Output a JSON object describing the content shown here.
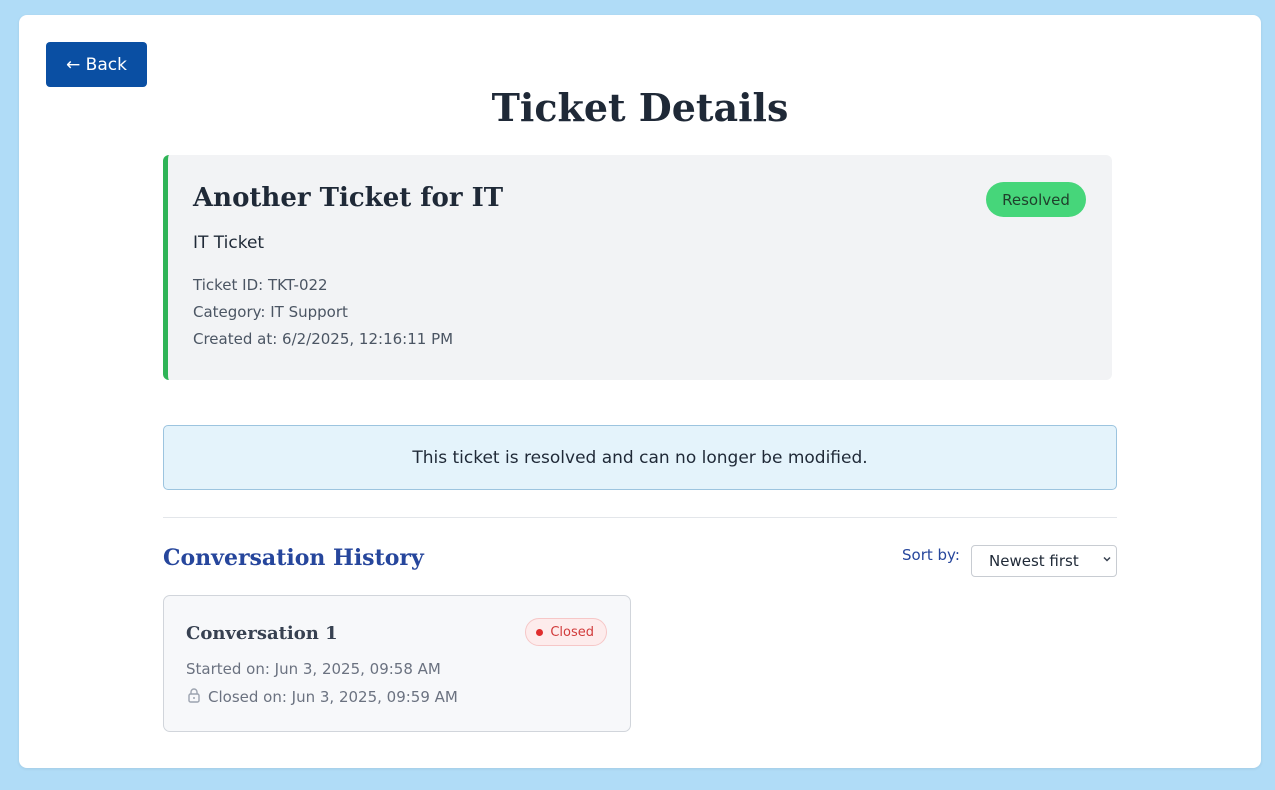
{
  "nav": {
    "back_label": "← Back"
  },
  "page": {
    "title": "Ticket Details"
  },
  "ticket": {
    "title": "Another Ticket for IT",
    "status": "Resolved",
    "subtitle": "IT Ticket",
    "id_line": "Ticket ID: TKT-022",
    "category_line": "Category: IT Support",
    "created_line": "Created at: 6/2/2025, 12:16:11 PM",
    "accent_color": "#2fb457",
    "status_color": "#46d67a"
  },
  "notice": {
    "text": "This ticket is resolved and can no longer be modified."
  },
  "conversations": {
    "heading": "Conversation History",
    "sort_label": "Sort by:",
    "sort_value": "Newest first",
    "items": [
      {
        "title": "Conversation 1",
        "status": "Closed",
        "started": "Started on: Jun 3, 2025, 09:58 AM",
        "closed": "Closed on: Jun 3, 2025, 09:59 AM",
        "status_color": "#e02d2d",
        "icon": "lock-icon"
      }
    ]
  },
  "colors": {
    "primary": "#0a4fa3",
    "background": "#b0dcf7",
    "heading_blue": "#26469c"
  }
}
